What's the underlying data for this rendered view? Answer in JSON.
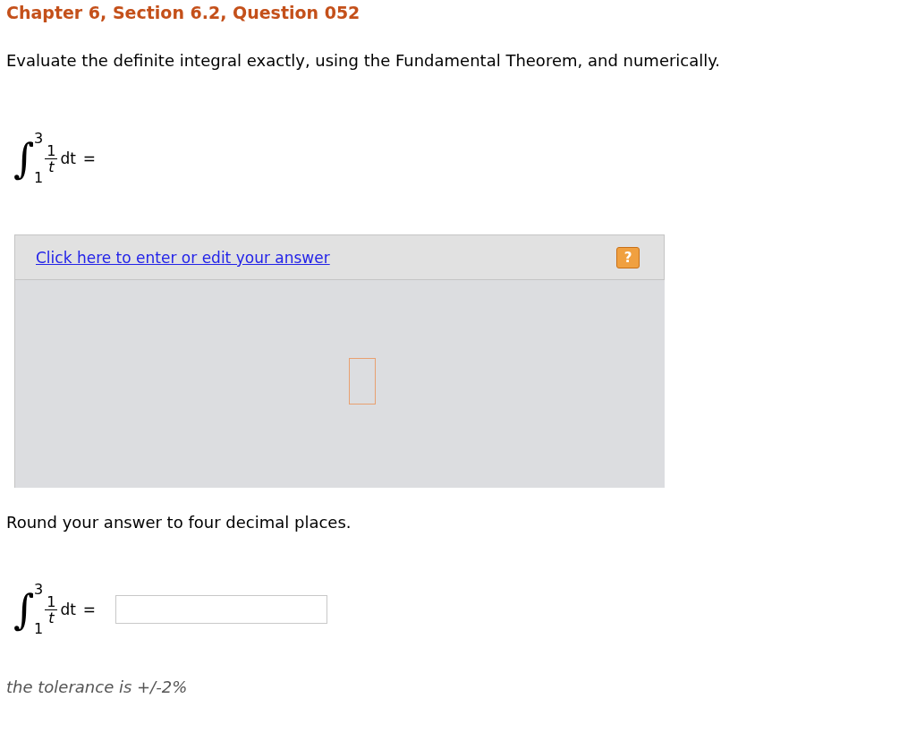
{
  "title": "Chapter 6, Section 6.2, Question 052",
  "instruction": "Evaluate the definite integral exactly, using the Fundamental Theorem, and numerically.",
  "exact_formula": {
    "sign": "∫",
    "upper": "3",
    "lower": "1",
    "numerator": "1",
    "denominator": "t",
    "differential": "dt",
    "equals": "="
  },
  "answer_panel": {
    "link": "Click here to enter or edit your answer",
    "help": "?"
  },
  "round_instruction": "Round your answer to four decimal places.",
  "numeric_formula": {
    "sign": "∫",
    "upper": "3",
    "lower": "1",
    "numerator": "1",
    "denominator": "t",
    "differential": "dt",
    "equals": "="
  },
  "tolerance": "the tolerance is +/-2%"
}
